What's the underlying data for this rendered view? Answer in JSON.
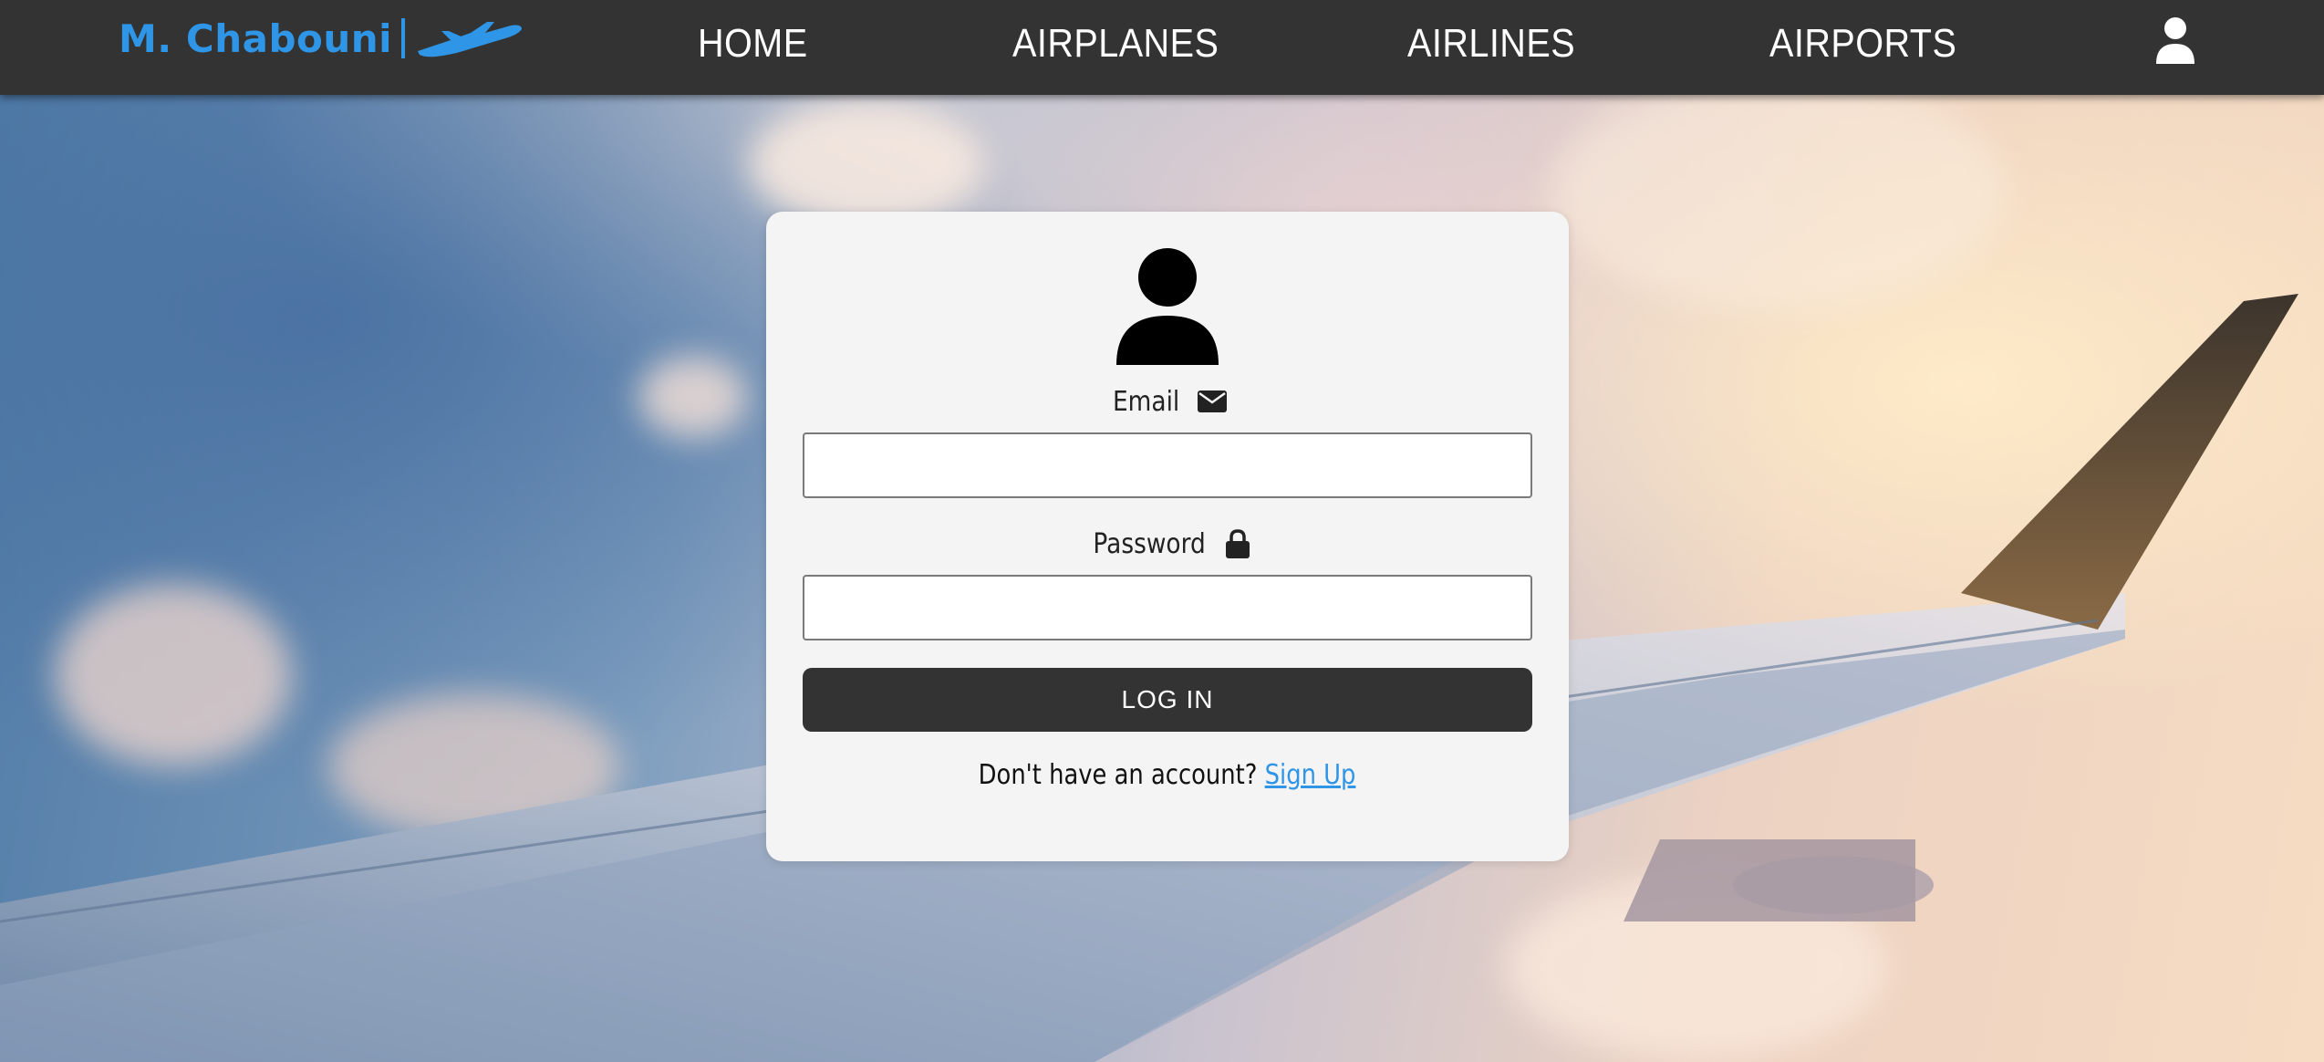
{
  "brand": {
    "name": "M. Chabouni",
    "color": "#2f95e6",
    "icon": "airplane-icon"
  },
  "nav": {
    "items": [
      {
        "label": "HOME"
      },
      {
        "label": "AIRPLANES"
      },
      {
        "label": "AIRLINES"
      },
      {
        "label": "AIRPORTS"
      }
    ],
    "user_icon": "user-icon"
  },
  "login": {
    "avatar_icon": "user-avatar-icon",
    "email": {
      "label": "Email",
      "icon": "envelope-icon",
      "value": "",
      "placeholder": ""
    },
    "password": {
      "label": "Password",
      "icon": "lock-icon",
      "value": "",
      "placeholder": ""
    },
    "submit_label": "LOG IN",
    "signup_prompt": "Don't have an account?",
    "signup_link": "Sign Up"
  },
  "colors": {
    "navbar": "#333333",
    "card": "#f4f4f4",
    "button": "#333333",
    "link": "#2f95e6"
  }
}
